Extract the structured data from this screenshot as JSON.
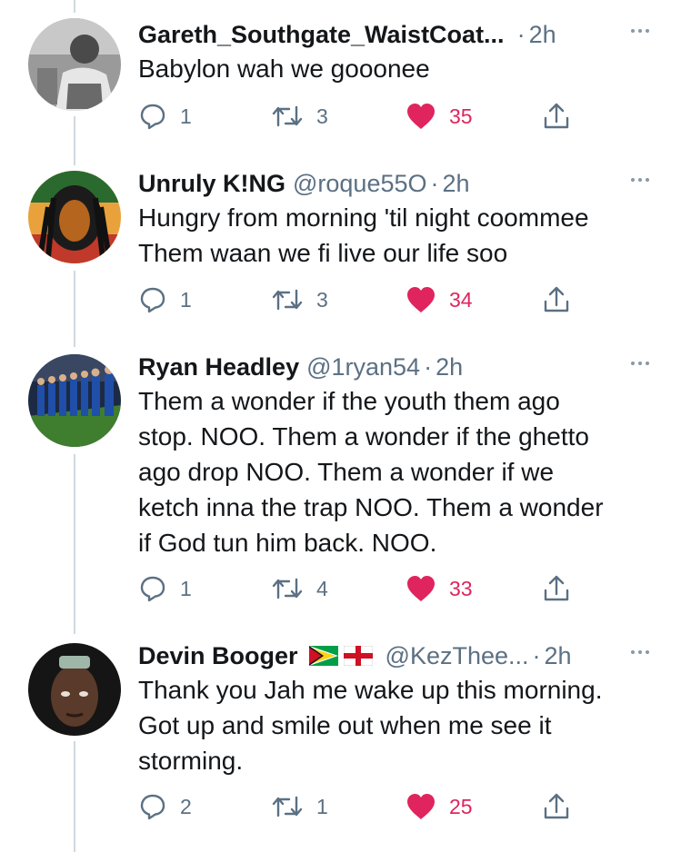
{
  "tweets": [
    {
      "name": "Gareth_Southgate_WaistCoat...",
      "handle": "",
      "time": "2h",
      "text": [
        "Babylon wah we gooonee"
      ],
      "replies": "1",
      "retweets": "3",
      "likes": "35"
    },
    {
      "name": "Unruly K!NG",
      "handle": "@roque55O",
      "time": "2h",
      "text": [
        "Hungry from morning 'til night coommee",
        "Them waan we fi live our life soo"
      ],
      "replies": "1",
      "retweets": "3",
      "likes": "34"
    },
    {
      "name": "Ryan Headley",
      "handle": "@1ryan54",
      "time": "2h",
      "text": [
        "Them a wonder if the youth them ago",
        "stop. NOO. Them a  wonder if the ghetto",
        "ago drop NOO. Them a wonder if we",
        "ketch inna the trap NOO. Them a wonder",
        "if God tun him back. NOO."
      ],
      "replies": "1",
      "retweets": "4",
      "likes": "33"
    },
    {
      "name": "Devin Booger",
      "handle": "@KezThee...",
      "time": "2h",
      "flags": [
        "guyana-flag-icon",
        "england-flag-icon"
      ],
      "text": [
        "Thank you Jah me wake up this morning.",
        "Got up and smile out when me see it",
        "storming."
      ],
      "replies": "2",
      "retweets": "1",
      "likes": "25"
    }
  ],
  "colors": {
    "like": "#e0245e",
    "secondary_text": "#5b7083",
    "thread_line": "#cfd9de"
  },
  "icons": [
    "reply-icon",
    "retweet-icon",
    "like-heart-icon",
    "share-icon",
    "more-options-icon"
  ]
}
